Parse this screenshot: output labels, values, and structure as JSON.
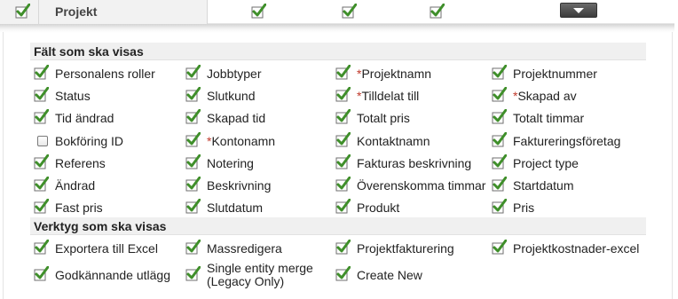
{
  "top": {
    "label": "Projekt"
  },
  "sections": {
    "fields_title": "Fält som ska visas",
    "tools_title": "Verktyg som ska visas"
  },
  "fields": [
    {
      "label": "Personalens roller",
      "checked": true,
      "required": false
    },
    {
      "label": "Jobbtyper",
      "checked": true,
      "required": false
    },
    {
      "label": "Projektnamn",
      "checked": true,
      "required": true
    },
    {
      "label": "Projektnummer",
      "checked": true,
      "required": false
    },
    {
      "label": "Status",
      "checked": true,
      "required": false
    },
    {
      "label": "Slutkund",
      "checked": true,
      "required": false
    },
    {
      "label": "Tilldelat till",
      "checked": true,
      "required": true
    },
    {
      "label": "Skapad av",
      "checked": true,
      "required": true
    },
    {
      "label": "Tid ändrad",
      "checked": true,
      "required": false
    },
    {
      "label": "Skapad tid",
      "checked": true,
      "required": false
    },
    {
      "label": "Totalt pris",
      "checked": true,
      "required": false
    },
    {
      "label": "Totalt timmar",
      "checked": true,
      "required": false
    },
    {
      "label": "Bokföring ID",
      "checked": false,
      "required": false
    },
    {
      "label": "Kontonamn",
      "checked": true,
      "required": true
    },
    {
      "label": "Kontaktnamn",
      "checked": true,
      "required": false
    },
    {
      "label": "Faktureringsföretag",
      "checked": true,
      "required": false
    },
    {
      "label": "Referens",
      "checked": true,
      "required": false
    },
    {
      "label": "Notering",
      "checked": true,
      "required": false
    },
    {
      "label": "Fakturas beskrivning",
      "checked": true,
      "required": false
    },
    {
      "label": "Project type",
      "checked": true,
      "required": false
    },
    {
      "label": "Ändrad",
      "checked": true,
      "required": false
    },
    {
      "label": "Beskrivning",
      "checked": true,
      "required": false
    },
    {
      "label": "Överenskomma timmar",
      "checked": true,
      "required": false
    },
    {
      "label": "Startdatum",
      "checked": true,
      "required": false
    },
    {
      "label": "Fast pris",
      "checked": true,
      "required": false
    },
    {
      "label": "Slutdatum",
      "checked": true,
      "required": false
    },
    {
      "label": "Produkt",
      "checked": true,
      "required": false
    },
    {
      "label": "Pris",
      "checked": true,
      "required": false
    }
  ],
  "tools": [
    {
      "label": "Exportera till Excel",
      "checked": true
    },
    {
      "label": "Massredigera",
      "checked": true
    },
    {
      "label": "Projektfakturering",
      "checked": true
    },
    {
      "label": "Projektkostnader-excel",
      "checked": true
    },
    {
      "label": "Godkännande utlägg",
      "checked": true
    },
    {
      "label": "Single entity merge (Legacy Only)",
      "checked": true
    },
    {
      "label": "Create New",
      "checked": true
    }
  ],
  "required_marker": "*",
  "colors": {
    "check_green": "#3f8f2a",
    "required_red": "#c0392b"
  }
}
